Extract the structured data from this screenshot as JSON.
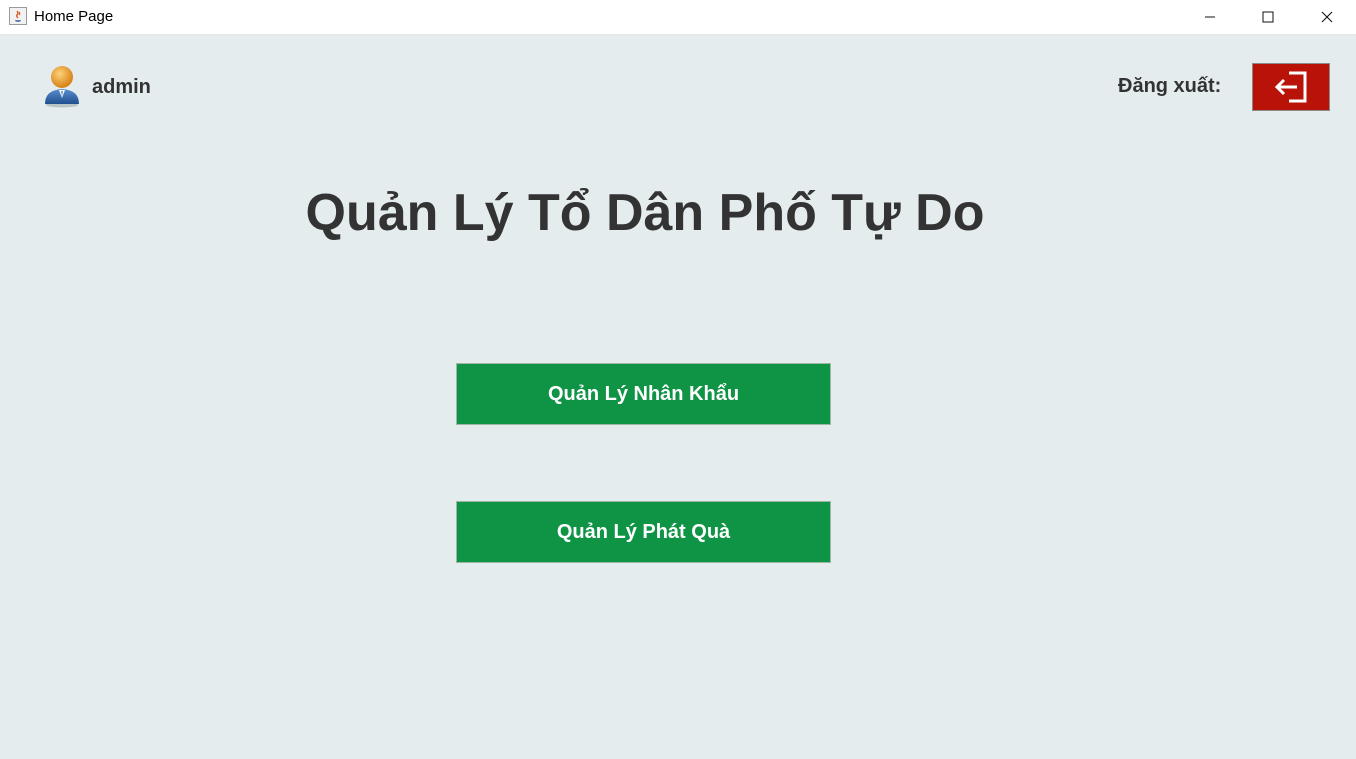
{
  "window": {
    "title": "Home Page",
    "controls": [
      "minimize-icon",
      "maximize-icon",
      "close-icon"
    ]
  },
  "header": {
    "username": "admin",
    "avatar_icon": "user-avatar-icon",
    "logout_label": "Đăng xuất:",
    "logout_icon": "logout-arrow-icon"
  },
  "main": {
    "title": "Quản Lý Tổ Dân Phố Tự Do",
    "buttons": [
      {
        "label": "Quản Lý Nhân Khẩu"
      },
      {
        "label": "Quản Lý Phát Quà"
      }
    ]
  },
  "colors": {
    "background": "#e4ecee",
    "primary_button": "#0f9446",
    "logout_button": "#b91208",
    "text": "#333333"
  }
}
